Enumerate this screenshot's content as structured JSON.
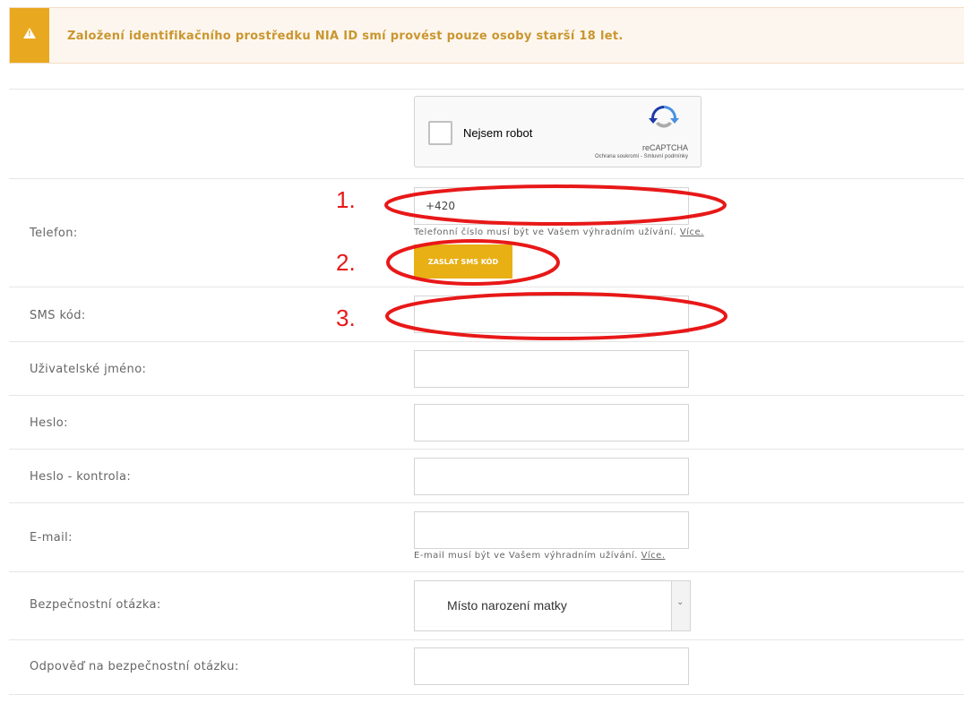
{
  "alert": {
    "text": "Založení identifikačního prostředku NIA ID smí provést pouze osoby starší 18 let."
  },
  "captcha": {
    "label": "Nejsem robot",
    "brand": "reCAPTCHA",
    "links": "Ochrana soukromí - Smluvní podmínky"
  },
  "phone": {
    "label": "Telefon:",
    "value": "+420",
    "hint": "Telefonní číslo musí být ve Vašem výhradním užívání.",
    "hint_link": "Více.",
    "send_button": "ZASLAT SMS KÓD"
  },
  "sms": {
    "label": "SMS kód:",
    "value": ""
  },
  "username": {
    "label": "Uživatelské jméno:",
    "value": ""
  },
  "password": {
    "label": "Heslo:",
    "value": ""
  },
  "password_check": {
    "label": "Heslo - kontrola:",
    "value": ""
  },
  "email": {
    "label": "E-mail:",
    "value": "",
    "hint": "E-mail musí být ve Vašem výhradním užívání.",
    "hint_link": "Více."
  },
  "security_question": {
    "label": "Bezpečnostní otázka:",
    "selected": "Místo narození matky"
  },
  "security_answer": {
    "label": "Odpověď na bezpečnostní otázku:",
    "value": ""
  },
  "annotations": {
    "step1": "1.",
    "step2": "2.",
    "step3": "3.",
    "color": "#e81818"
  },
  "colors": {
    "accent": "#e8b015",
    "alert_text": "#c9962f",
    "alert_bg": "#fdf6ee"
  }
}
